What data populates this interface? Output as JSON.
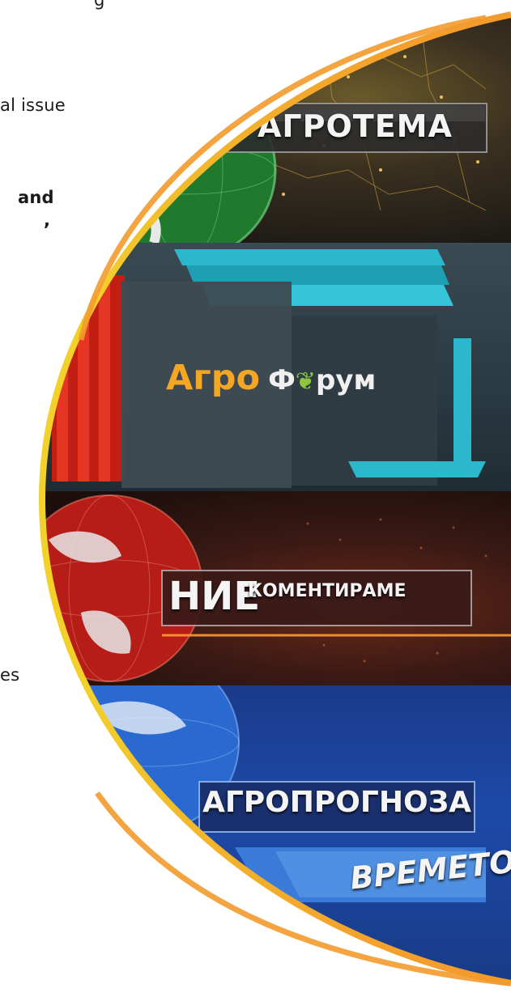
{
  "page": {
    "header_text": "g",
    "left_text_lines": [
      {
        "text": "al issue",
        "bold": false
      },
      {
        "text": "and",
        "bold": true
      },
      {
        "text": ",",
        "bold": true
      },
      {
        "text": "es",
        "bold": false
      }
    ]
  },
  "banners": [
    {
      "label": "АГРОТЕМА",
      "theme": "green-globe"
    },
    {
      "label_part1": "Агро",
      "label_part2": "Ф",
      "label_part3": "рум",
      "theme": "teal-red-blocks"
    },
    {
      "label_big": "НИЕ",
      "label_small": "КОМЕНТИРАМЕ",
      "theme": "red-globe"
    },
    {
      "label": "АГРОПРОГНОЗА",
      "label2": "ВРЕМЕТО",
      "theme": "blue-globe"
    }
  ],
  "colors": {
    "accent_orange": "#f39a2c",
    "accent_yellow": "#f2d12a",
    "agro_orange": "#f5a623",
    "teal": "#29b6c9",
    "red": "#d42a1e"
  }
}
